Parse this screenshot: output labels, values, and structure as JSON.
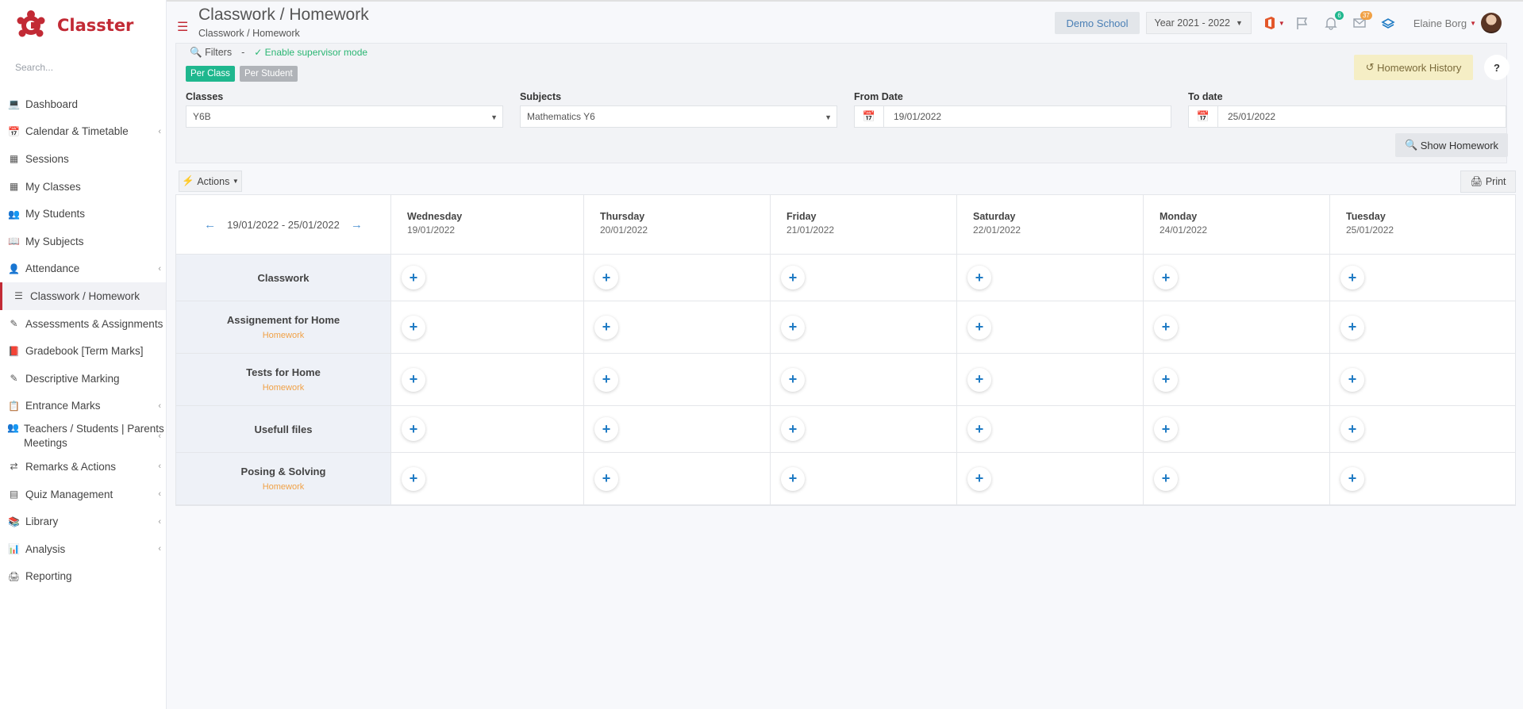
{
  "brand": {
    "name": "Classter",
    "color": "#c22a35"
  },
  "search": {
    "placeholder": "Search..."
  },
  "sidebar": {
    "items": [
      {
        "label": "Dashboard",
        "icon": "laptop-icon",
        "chevron": false
      },
      {
        "label": "Calendar & Timetable",
        "icon": "calendar-icon",
        "chevron": true
      },
      {
        "label": "Sessions",
        "icon": "sessions-icon",
        "chevron": false
      },
      {
        "label": "My Classes",
        "icon": "classes-icon",
        "chevron": false
      },
      {
        "label": "My Students",
        "icon": "students-icon",
        "chevron": false
      },
      {
        "label": "My Subjects",
        "icon": "book-icon",
        "chevron": false
      },
      {
        "label": "Attendance",
        "icon": "attendance-icon",
        "chevron": true
      },
      {
        "label": "Classwork / Homework",
        "icon": "checklist-icon",
        "chevron": false,
        "active": true
      },
      {
        "label": "Assessments & Assignments",
        "icon": "edit-icon",
        "chevron": true
      },
      {
        "label": "Gradebook [Term Marks]",
        "icon": "gradebook-icon",
        "chevron": false
      },
      {
        "label": "Descriptive Marking",
        "icon": "marking-icon",
        "chevron": false
      },
      {
        "label": "Entrance Marks",
        "icon": "clipboard-icon",
        "chevron": true
      },
      {
        "label": "Teachers / Students | Parents Meetings",
        "icon": "meeting-icon",
        "chevron": true
      },
      {
        "label": "Remarks & Actions",
        "icon": "shuffle-icon",
        "chevron": true
      },
      {
        "label": "Quiz Management",
        "icon": "quiz-icon",
        "chevron": true
      },
      {
        "label": "Library",
        "icon": "library-icon",
        "chevron": true
      },
      {
        "label": "Analysis",
        "icon": "chart-icon",
        "chevron": true
      },
      {
        "label": "Reporting",
        "icon": "printer-icon",
        "chevron": false
      }
    ]
  },
  "header": {
    "title": "Classwork / Homework",
    "breadcrumb": "Classwork / Homework",
    "school": "Demo School",
    "year": "Year 2021 - 2022",
    "notifications": "6",
    "messages": "37",
    "user": "Elaine Borg"
  },
  "filters": {
    "label": "Filters",
    "separator": "-",
    "supervisor": "Enable supervisor mode",
    "per_class": "Per Class",
    "per_student": "Per Student",
    "classes_label": "Classes",
    "classes_value": "Y6B",
    "subjects_label": "Subjects",
    "subjects_value": "Mathematics Y6",
    "from_label": "From Date",
    "from_value": "19/01/2022",
    "to_label": "To date",
    "to_value": "25/01/2022",
    "history": "Homework History",
    "help": "?",
    "show": "Show Homework"
  },
  "toolbar": {
    "actions": "Actions",
    "print": "Print"
  },
  "grid": {
    "range": "19/01/2022 - 25/01/2022",
    "days": [
      {
        "name": "Wednesday",
        "date": "19/01/2022"
      },
      {
        "name": "Thursday",
        "date": "20/01/2022"
      },
      {
        "name": "Friday",
        "date": "21/01/2022"
      },
      {
        "name": "Saturday",
        "date": "22/01/2022"
      },
      {
        "name": "Monday",
        "date": "24/01/2022"
      },
      {
        "name": "Tuesday",
        "date": "25/01/2022"
      }
    ],
    "rows": [
      {
        "title": "Classwork",
        "sub": ""
      },
      {
        "title": "Assignement for Home",
        "sub": "Homework"
      },
      {
        "title": "Tests for Home",
        "sub": "Homework"
      },
      {
        "title": "Usefull files",
        "sub": ""
      },
      {
        "title": "Posing & Solving",
        "sub": "Homework"
      }
    ]
  }
}
